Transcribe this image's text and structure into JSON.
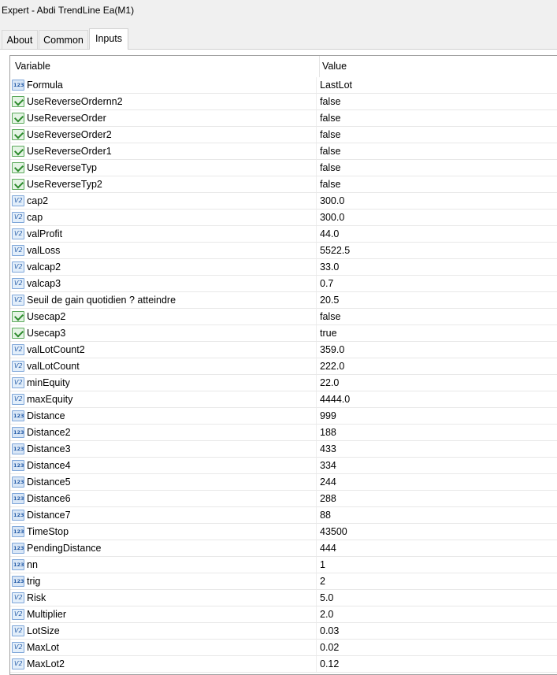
{
  "window": {
    "title": "Expert - Abdi TrendLine Ea(M1)"
  },
  "tabs": [
    {
      "label": "About"
    },
    {
      "label": "Common"
    },
    {
      "label": "Inputs",
      "active": true
    }
  ],
  "grid": {
    "columns": {
      "variable": "Variable",
      "value": "Value"
    },
    "rows": [
      {
        "type": "num",
        "name": "Formula",
        "value": "LastLot"
      },
      {
        "type": "bool",
        "name": "UseReverseOrdernn2",
        "value": "false"
      },
      {
        "type": "bool",
        "name": "UseReverseOrder",
        "value": "false"
      },
      {
        "type": "bool",
        "name": "UseReverseOrder2",
        "value": "false"
      },
      {
        "type": "bool",
        "name": "UseReverseOrder1",
        "value": "false"
      },
      {
        "type": "bool",
        "name": "UseReverseTyp",
        "value": "false"
      },
      {
        "type": "bool",
        "name": "UseReverseTyp2",
        "value": "false"
      },
      {
        "type": "dbl",
        "name": "cap2",
        "value": "300.0"
      },
      {
        "type": "dbl",
        "name": "cap",
        "value": "300.0"
      },
      {
        "type": "dbl",
        "name": "valProfit",
        "value": "44.0"
      },
      {
        "type": "dbl",
        "name": "valLoss",
        "value": "5522.5"
      },
      {
        "type": "dbl",
        "name": "valcap2",
        "value": "33.0"
      },
      {
        "type": "dbl",
        "name": "valcap3",
        "value": "0.7"
      },
      {
        "type": "dbl",
        "name": "Seuil de gain quotidien ? atteindre",
        "value": "20.5"
      },
      {
        "type": "bool",
        "name": "Usecap2",
        "value": "false"
      },
      {
        "type": "bool",
        "name": "Usecap3",
        "value": "true"
      },
      {
        "type": "dbl",
        "name": "valLotCount2",
        "value": "359.0"
      },
      {
        "type": "dbl",
        "name": "valLotCount",
        "value": "222.0"
      },
      {
        "type": "dbl",
        "name": "minEquity",
        "value": "22.0"
      },
      {
        "type": "dbl",
        "name": "maxEquity",
        "value": "4444.0"
      },
      {
        "type": "num",
        "name": "Distance",
        "value": "999"
      },
      {
        "type": "num",
        "name": "Distance2",
        "value": "188"
      },
      {
        "type": "num",
        "name": "Distance3",
        "value": "433"
      },
      {
        "type": "num",
        "name": "Distance4",
        "value": "334"
      },
      {
        "type": "num",
        "name": "Distance5",
        "value": "244"
      },
      {
        "type": "num",
        "name": "Distance6",
        "value": "288"
      },
      {
        "type": "num",
        "name": "Distance7",
        "value": "88"
      },
      {
        "type": "num",
        "name": "TimeStop",
        "value": "43500"
      },
      {
        "type": "num",
        "name": "PendingDistance",
        "value": "444"
      },
      {
        "type": "num",
        "name": "nn",
        "value": "1"
      },
      {
        "type": "num",
        "name": "trig",
        "value": "2"
      },
      {
        "type": "dbl",
        "name": "Risk",
        "value": "5.0"
      },
      {
        "type": "dbl",
        "name": "Multiplier",
        "value": "2.0"
      },
      {
        "type": "dbl",
        "name": "LotSize",
        "value": "0.03"
      },
      {
        "type": "dbl",
        "name": "MaxLot",
        "value": "0.02"
      },
      {
        "type": "dbl",
        "name": "MaxLot2",
        "value": "0.12"
      }
    ]
  }
}
